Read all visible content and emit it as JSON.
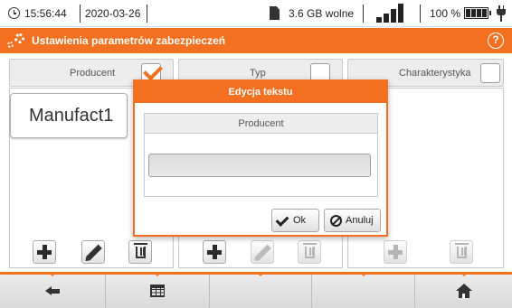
{
  "status": {
    "time": "15:56:44",
    "date": "2020-03-26",
    "storage": "3.6 GB wolne",
    "battery": "100 %"
  },
  "titlebar": {
    "title": "Ustawienia parametrów zabezpieczeń",
    "help": "?"
  },
  "columns": [
    {
      "header": "Producent",
      "checked": true,
      "value": "Manufact1"
    },
    {
      "header": "Typ",
      "checked": false
    },
    {
      "header": "Charakterystyka",
      "checked": false
    }
  ],
  "dialog": {
    "title": "Edycja tekstu",
    "field_label": "Producent",
    "input_value": "",
    "ok_label": "Ok",
    "cancel_label": "Anuluj"
  },
  "bottom_nav": [
    "back-icon",
    "table-icon",
    "",
    "",
    "home-icon"
  ],
  "colors": {
    "accent": "#f37021"
  }
}
